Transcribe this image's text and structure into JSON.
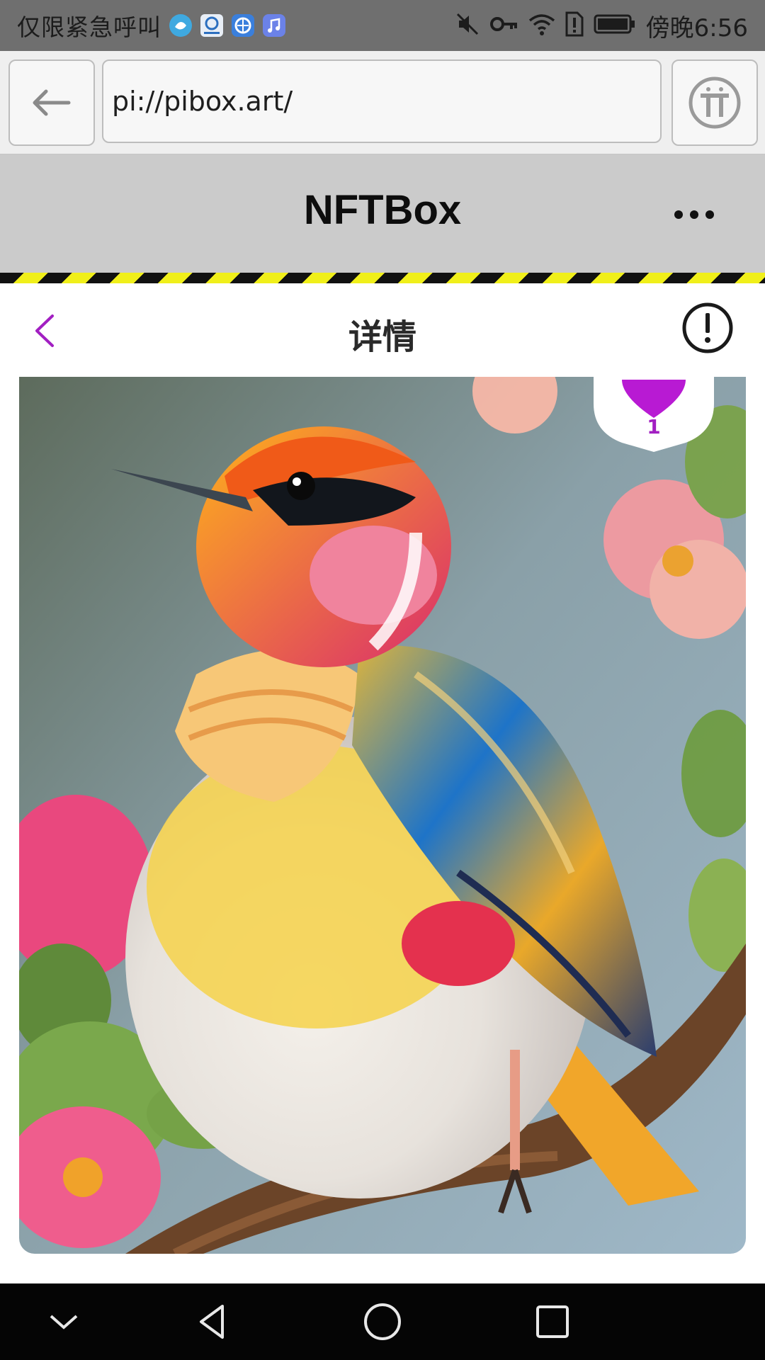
{
  "status_bar": {
    "carrier_text": "仅限紧急呼叫",
    "time": "傍晚6:56",
    "icons": [
      "weibo-icon",
      "app-icon",
      "browser-icon",
      "music-icon",
      "mute-icon",
      "key-icon",
      "wifi-icon",
      "sim-alert-icon",
      "battery-icon"
    ]
  },
  "browser": {
    "url": "pi://pibox.art/",
    "back_icon": "arrow-left-icon",
    "pi_icon": "pi-logo-icon"
  },
  "app": {
    "title": "NFTBox",
    "more_icon": "more-dots-icon"
  },
  "detail": {
    "title": "详情",
    "back_icon": "chevron-left-icon",
    "info_icon": "info-circle-icon"
  },
  "nft": {
    "likes": "1",
    "like_icon": "heart-icon"
  },
  "colors": {
    "accent_purple": "#a21fc2",
    "header_gray": "#cbcbcb",
    "hazard_yellow": "#f0ef1a"
  }
}
